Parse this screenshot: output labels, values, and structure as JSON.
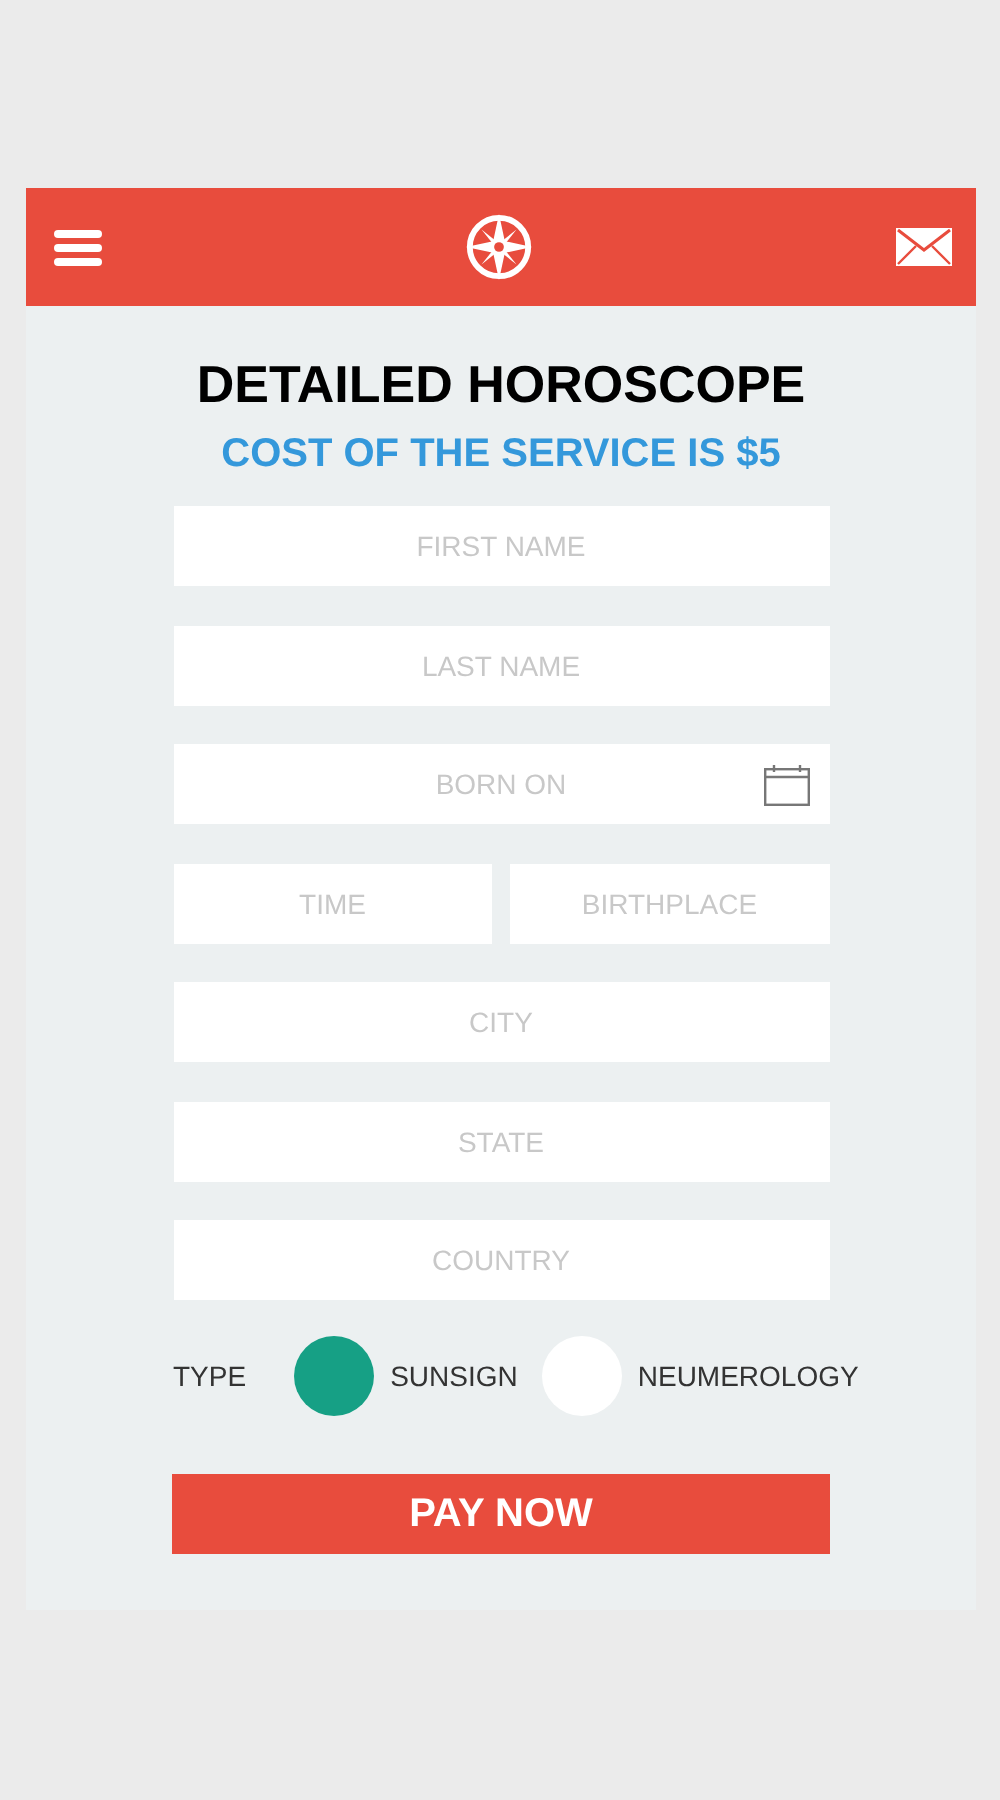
{
  "header": {
    "title": "DETAILED HOROSCOPE",
    "subtitle": "COST OF THE SERVICE IS $5"
  },
  "form_rows": [
    {
      "fields": [
        {
          "placeholder": "FIRST NAME",
          "kind": "text"
        }
      ]
    },
    {
      "fields": [
        {
          "placeholder": "LAST NAME",
          "kind": "text"
        }
      ]
    },
    {
      "fields": [
        {
          "placeholder": "BORN ON",
          "kind": "date"
        }
      ]
    },
    {
      "fields": [
        {
          "placeholder": "TIME",
          "kind": "text"
        },
        {
          "placeholder": "BIRTHPLACE",
          "kind": "text"
        }
      ]
    },
    {
      "fields": [
        {
          "placeholder": "CITY",
          "kind": "text"
        }
      ]
    },
    {
      "fields": [
        {
          "placeholder": "STATE",
          "kind": "text"
        }
      ]
    },
    {
      "fields": [
        {
          "placeholder": "COUNTRY",
          "kind": "text"
        }
      ]
    }
  ],
  "type_choice": {
    "label": "TYPE",
    "options": [
      {
        "label": "SUNSIGN",
        "selected": true
      },
      {
        "label": "NEUMEROLOGY",
        "selected": false
      }
    ]
  },
  "submit": {
    "label": "PAY NOW"
  }
}
